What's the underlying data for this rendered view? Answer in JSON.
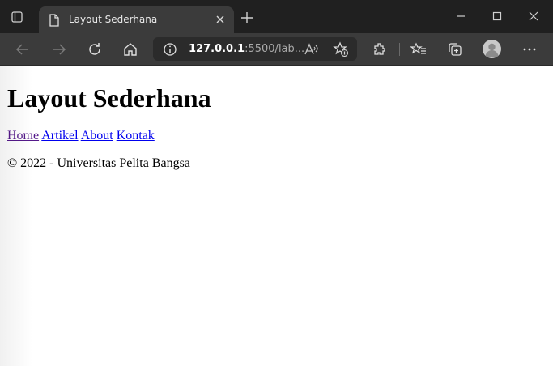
{
  "browser": {
    "tab_title": "Layout Sederhana",
    "address": {
      "host": "127.0.0.1",
      "rest": ":5500/lab..."
    }
  },
  "page": {
    "heading": "Layout Sederhana",
    "nav": [
      {
        "label": "Home"
      },
      {
        "label": "Artikel"
      },
      {
        "label": "About"
      },
      {
        "label": "Kontak"
      }
    ],
    "footer": "© 2022 - Universitas Pelita Bangsa"
  }
}
